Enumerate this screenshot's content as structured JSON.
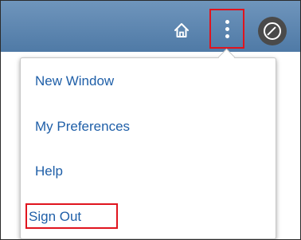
{
  "header": {
    "home_icon": "home-icon",
    "actions_icon": "vertical-dots-icon",
    "navigator_icon": "compass-icon",
    "highlight_color": "#e0141e",
    "bar_color": "#5a84ae"
  },
  "menu": {
    "items": [
      {
        "label": "New Window"
      },
      {
        "label": "My Preferences"
      },
      {
        "label": "Help"
      },
      {
        "label": "Sign Out"
      }
    ],
    "text_color": "#1f5fa8"
  }
}
